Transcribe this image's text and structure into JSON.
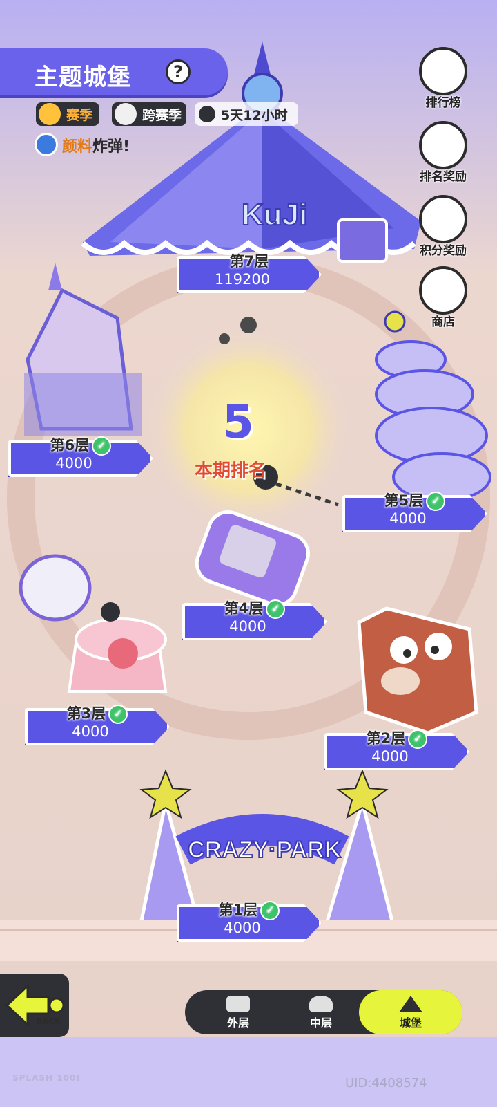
{
  "header": {
    "title": "主题城堡",
    "season_label": "赛季",
    "cross_season_label": "跨赛季",
    "timer": "5天12小时",
    "bomb_prefix": "颜料",
    "bomb_suffix": "炸弹!"
  },
  "side_menu": [
    {
      "label": "排行榜",
      "icon": "trophy-icon"
    },
    {
      "label": "排名奖励",
      "icon": "rank-reward-icon"
    },
    {
      "label": "积分奖励",
      "icon": "points-reward-icon"
    },
    {
      "label": "商店",
      "icon": "cart-icon"
    }
  ],
  "levels": [
    {
      "name": "第7层",
      "score": "119200",
      "completed": false
    },
    {
      "name": "第6层",
      "score": "4000",
      "completed": true
    },
    {
      "name": "第5层",
      "score": "4000",
      "completed": true
    },
    {
      "name": "第4层",
      "score": "4000",
      "completed": true
    },
    {
      "name": "第3层",
      "score": "4000",
      "completed": true
    },
    {
      "name": "第2层",
      "score": "4000",
      "completed": true
    },
    {
      "name": "第1层",
      "score": "4000",
      "completed": true
    }
  ],
  "rank": {
    "value": "5",
    "label": "本期排名"
  },
  "tent_sign": "KuJi",
  "gate_sign": "CRAZY·PARK",
  "tabs": [
    {
      "label": "外层",
      "icon": "outer-layer-icon",
      "active": false
    },
    {
      "label": "中层",
      "icon": "middle-layer-icon",
      "active": false
    },
    {
      "label": "城堡",
      "icon": "castle-icon",
      "active": true
    }
  ],
  "back_label": "BACK",
  "footer_logo": "SPLASH 100!",
  "uid": "UID:4408574",
  "colors": {
    "accent": "#5b55e6",
    "active_tab": "#e6f53b",
    "check": "#3ec36b",
    "rank": "#e14a34"
  }
}
